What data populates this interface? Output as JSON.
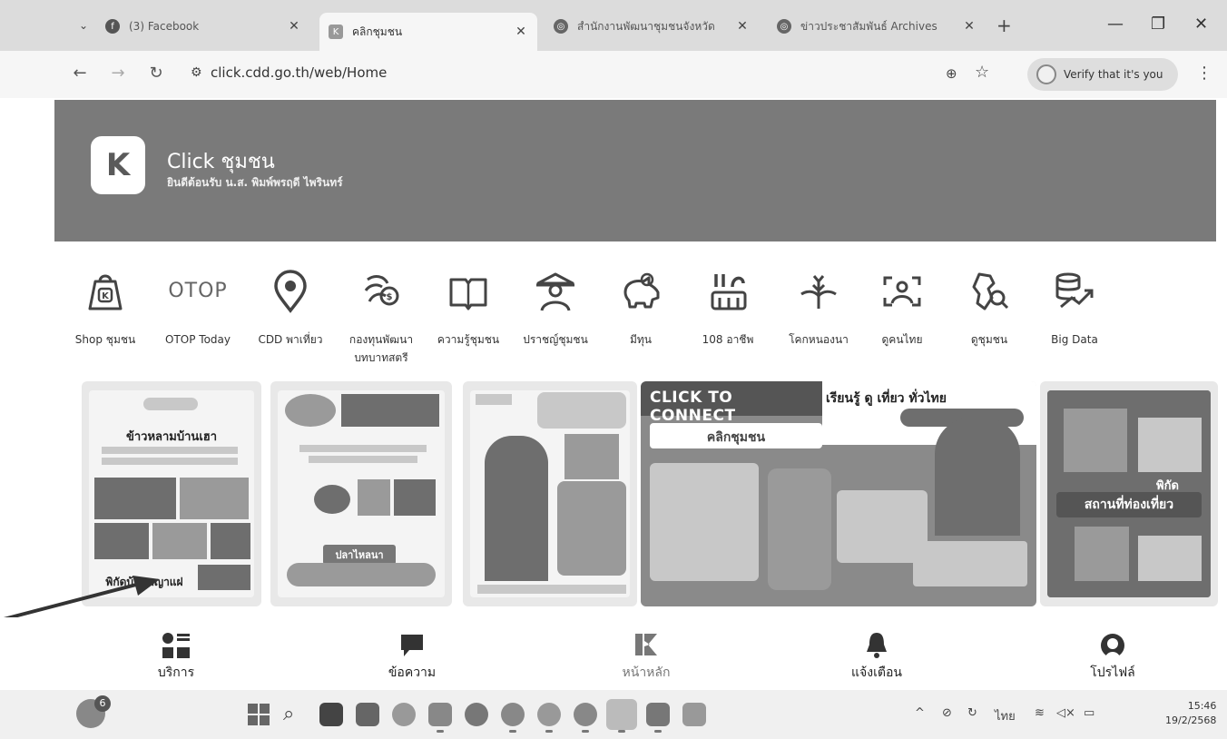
{
  "browser": {
    "tabs": [
      {
        "title": "(3) Facebook",
        "icon": "facebook-icon",
        "active": false
      },
      {
        "title": "คลิกชุมชน",
        "icon": "click-logo-icon",
        "active": true
      },
      {
        "title": "สำนักงานพัฒนาชุมชนจังหวัด",
        "icon": "globe-icon",
        "active": false
      },
      {
        "title": "ข่าวประชาสัมพันธ์ Archives",
        "icon": "globe-icon",
        "active": false
      }
    ],
    "url": "click.cdd.go.th/web/Home",
    "verify_label": "Verify that it's you"
  },
  "banner": {
    "title": "Click ชุมชน",
    "welcome": "ยินดีต้อนรับ น.ส. พิมพ์พรฤดี ไพรินทร์",
    "background_color": "#7a7a7a"
  },
  "services": [
    {
      "label": "Shop ชุมชน",
      "icon": "shopping-bag-icon"
    },
    {
      "label": "OTOP Today",
      "icon": "otop-logo",
      "logo_text": "OTOP"
    },
    {
      "label": "CDD พาเที่ยว",
      "icon": "location-pin-icon"
    },
    {
      "label": "กองทุนพัฒนาบทบาทสตรี",
      "icon": "women-fund-icon"
    },
    {
      "label": "ความรู้ชุมชน",
      "icon": "open-book-icon"
    },
    {
      "label": "ปราชญ์ชุมชน",
      "icon": "sage-person-icon"
    },
    {
      "label": "มีทุน",
      "icon": "piggy-bank-icon"
    },
    {
      "label": "108 อาชีพ",
      "icon": "tools-icon"
    },
    {
      "label": "โคกหนองนา",
      "icon": "plant-icon"
    },
    {
      "label": "ดูคนไทย",
      "icon": "person-scan-icon"
    },
    {
      "label": "ดูชุมชน",
      "icon": "map-search-icon"
    },
    {
      "label": "Big Data",
      "icon": "database-chart-icon"
    }
  ],
  "cards": [
    {
      "caption_top": "ข้าวหลามบ้านเฮา",
      "caption_bottom": "พิกัดบ้านพญาแฝ"
    },
    {
      "caption_top": "ปลาไหลนา",
      "caption_bottom": ""
    },
    {
      "caption_top": "",
      "caption_bottom": ""
    },
    {
      "heading": "CLICK  TO CONNECT",
      "side_text": "เรียนรู้ ดู เที่ยว ทั่วไทย",
      "pill": "คลิกชุมชน"
    },
    {
      "caption_top": "พิกัด",
      "caption_bottom": "สถานที่ท่องเที่ยว"
    }
  ],
  "bottom_nav": [
    {
      "label": "บริการ",
      "icon": "services-grid-icon"
    },
    {
      "label": "ข้อความ",
      "icon": "message-icon"
    },
    {
      "label": "หน้าหลัก",
      "icon": "home-logo-icon",
      "active": true
    },
    {
      "label": "แจ้งเตือน",
      "icon": "bell-icon"
    },
    {
      "label": "โปรไฟล์",
      "icon": "profile-icon"
    }
  ],
  "taskbar": {
    "badge_count": "6",
    "language": "ไทย",
    "time": "15:46",
    "date": "19/2/2568"
  }
}
